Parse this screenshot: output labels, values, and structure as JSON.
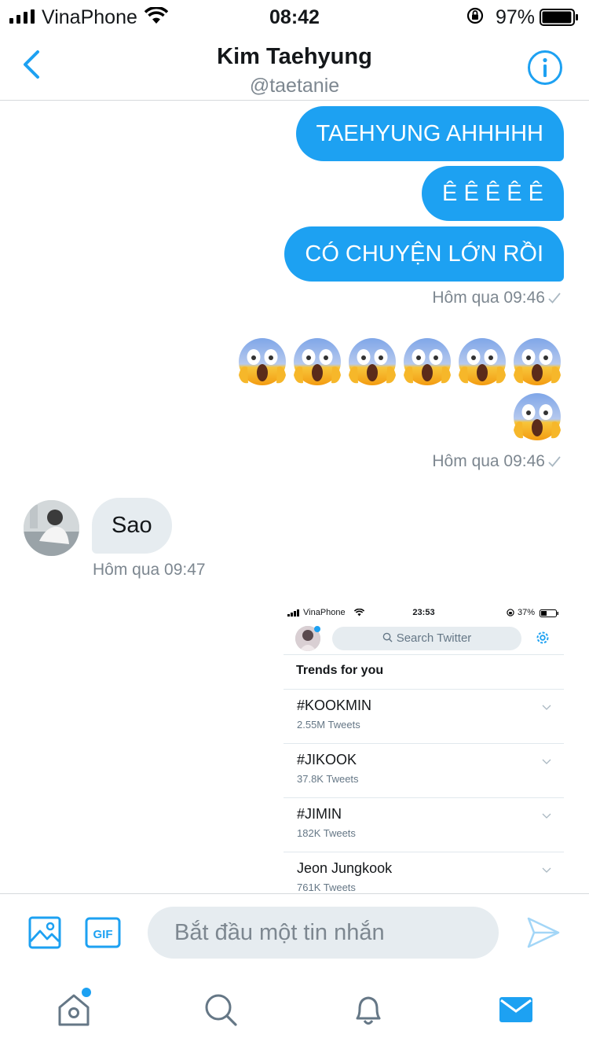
{
  "status_bar": {
    "carrier": "VinaPhone",
    "time": "08:42",
    "battery": "97%",
    "battery_level": 0.97
  },
  "header": {
    "name": "Kim Taehyung",
    "handle": "@taetanie"
  },
  "messages_out_1": [
    "TAEHYUNG AHHHHH",
    "Ê Ê Ê Ê Ê",
    "CÓ CHUYỆN LỚN RỒI"
  ],
  "timestamp_1": "Hôm qua 09:46",
  "emoji_count": 7,
  "emoji_name": "face-screaming-in-fear",
  "timestamp_2": "Hôm qua 09:46",
  "message_in": {
    "text": "Sao",
    "timestamp": "Hôm qua 09:47"
  },
  "shared_screenshot": {
    "status": {
      "carrier": "VinaPhone",
      "time": "23:53",
      "battery": "37%"
    },
    "search_placeholder": "Search Twitter",
    "section_title": "Trends for you",
    "trends": [
      {
        "name": "#KOOKMIN",
        "count": "2.55M Tweets"
      },
      {
        "name": "#JIKOOK",
        "count": "37.8K Tweets"
      },
      {
        "name": "#JIMIN",
        "count": "182K Tweets"
      },
      {
        "name": "Jeon Jungkook",
        "count": "761K Tweets"
      }
    ]
  },
  "composer": {
    "placeholder": "Bắt đầu một tin nhắn"
  },
  "tabbar": {
    "items": [
      "home-icon",
      "search-icon",
      "notifications-icon",
      "messages-icon"
    ],
    "active": "messages-icon"
  },
  "colors": {
    "accent": "#1da1f2",
    "bubble_in": "#e6ecf0",
    "meta_text": "#7d8790"
  }
}
